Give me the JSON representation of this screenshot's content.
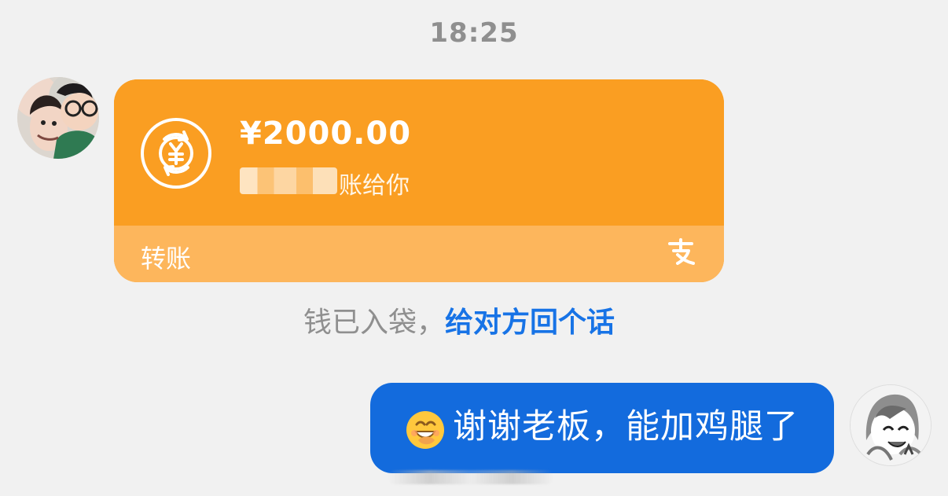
{
  "chat": {
    "timestamp": "18:25",
    "transfer": {
      "amount": "¥2000.00",
      "note_visible": "账给你",
      "label": "转账",
      "icon": "transfer-icon",
      "provider_icon": "alipay-icon"
    },
    "status": {
      "received_text": "钱已入袋，",
      "reply_prompt": "给对方回个话"
    },
    "message": {
      "emoji_icon": "grinning-emoji-icon",
      "text": "谢谢老板，能加鸡腿了"
    },
    "colors": {
      "background": "#f1f1f1",
      "transfer_card": "#fa9e22",
      "transfer_card_footer": "#fdb65c",
      "link_blue": "#1773e6",
      "message_bubble": "#136bdd",
      "timestamp_gray": "#8f8f8f"
    }
  }
}
